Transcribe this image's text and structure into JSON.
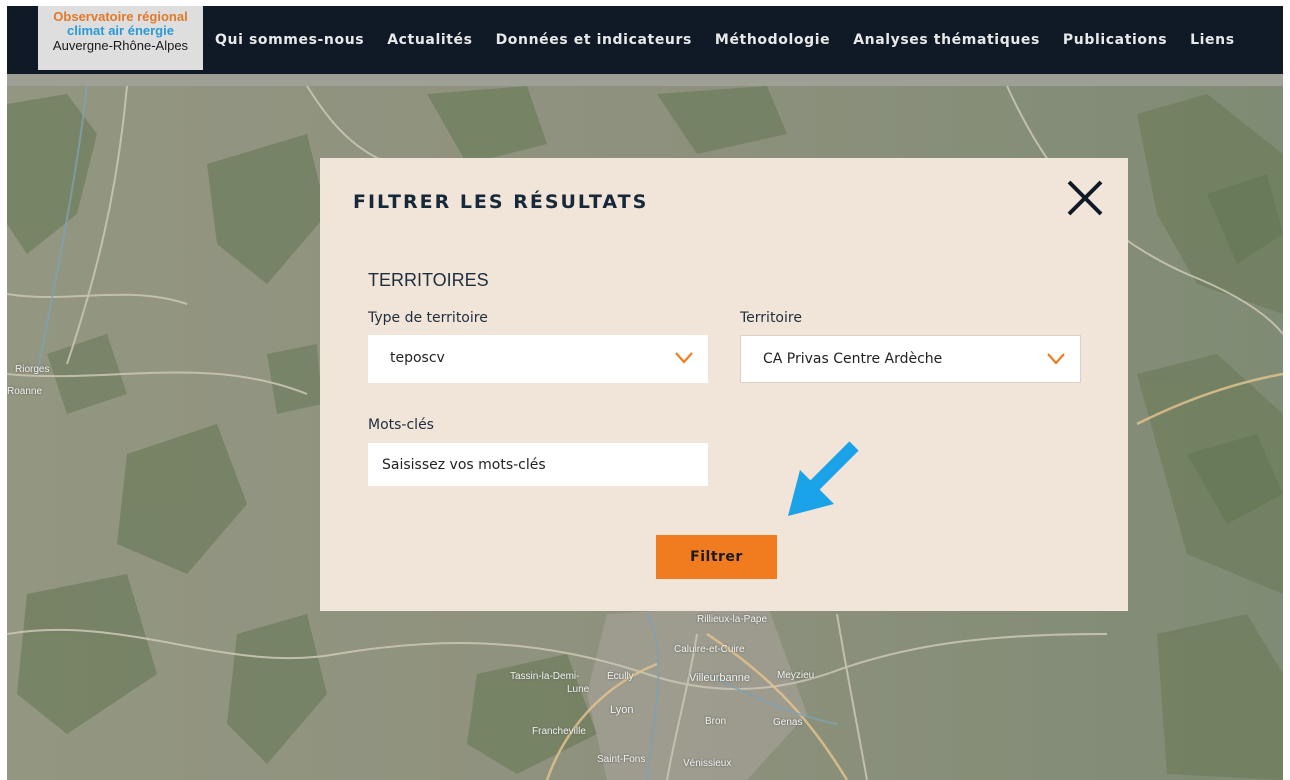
{
  "logo": {
    "line1": "Observatoire régional",
    "line2": "climat air énergie",
    "line3": "Auvergne-Rhône-Alpes"
  },
  "nav": {
    "items": [
      {
        "label": "Qui sommes-nous"
      },
      {
        "label": "Actualités"
      },
      {
        "label": "Données et indicateurs"
      },
      {
        "label": "Méthodologie"
      },
      {
        "label": "Analyses thématiques"
      },
      {
        "label": "Publications"
      },
      {
        "label": "Liens"
      }
    ]
  },
  "map": {
    "labels": [
      "Riorges",
      "Roanne",
      "Rillieux-la-Pape",
      "Caluire-et-Cuire",
      "Tassin-la-Demi-",
      "Lune",
      "Écully",
      "Villeurbanne",
      "Meyzieu",
      "Lyon",
      "Bron",
      "Genas",
      "Francheville",
      "Saint-Fons",
      "Vénissieux"
    ]
  },
  "modal": {
    "title": "FILTRER LES RÉSULTATS",
    "close_icon": "close-icon",
    "section_title": "TERRITOIRES",
    "type_label": "Type de territoire",
    "type_value": "teposcv",
    "territory_label": "Territoire",
    "territory_value": "CA Privas Centre Ardèche",
    "keywords_label": "Mots-clés",
    "keywords_placeholder": "Saisissez vos mots-clés",
    "keywords_value": "",
    "filter_button": "Filtrer"
  },
  "colors": {
    "nav_bg": "#0f1a26",
    "modal_bg": "#f1e4d8",
    "accent_orange": "#f07c1f",
    "arrow_blue": "#1aa3e8",
    "title_navy": "#17283a"
  }
}
